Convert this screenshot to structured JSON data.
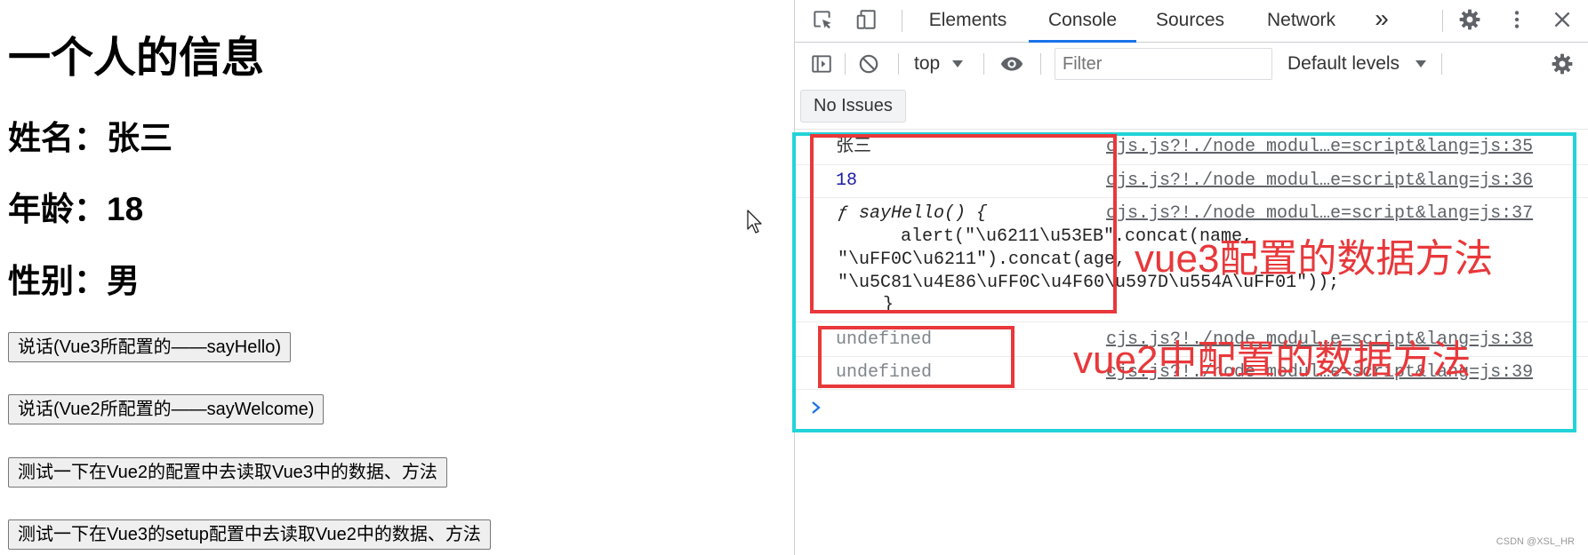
{
  "page": {
    "heading": "一个人的信息",
    "fields": [
      {
        "label": "姓名：",
        "value": "张三"
      },
      {
        "label": "年龄：",
        "value": "18"
      },
      {
        "label": "性别：",
        "value": "男"
      }
    ],
    "buttons": [
      "说话(Vue3所配置的——sayHello)",
      "说话(Vue2所配置的——sayWelcome)",
      "测试一下在Vue2的配置中去读取Vue3中的数据、方法",
      "测试一下在Vue3的setup配置中去读取Vue2中的数据、方法"
    ]
  },
  "devtools": {
    "toolbar": {
      "tabs": [
        {
          "label": "Elements",
          "active": false
        },
        {
          "label": "Console",
          "active": true
        },
        {
          "label": "Sources",
          "active": false
        },
        {
          "label": "Network",
          "active": false
        }
      ],
      "overflow": "»",
      "icons": [
        "inspect-element-icon",
        "device-toolbar-icon",
        "settings-gear-icon",
        "more-options-icon",
        "close-icon"
      ]
    },
    "console_toolbar": {
      "context": "top",
      "filter_placeholder": "Filter",
      "levels": "Default levels",
      "icons": [
        "sidebar-toggle-icon",
        "clear-console-icon",
        "live-expression-eye-icon",
        "console-settings-gear-icon"
      ]
    },
    "issues": "No Issues",
    "messages": [
      {
        "text": "张三",
        "source": "cjs.js?!./node_modul…e=script&lang=js:35"
      },
      {
        "text": "18",
        "source": "cjs.js?!./node_modul…e=script&lang=js:36"
      },
      {
        "lines": [
          "ƒ sayHello() {",
          "alert(\"\\u6211\\u53EB\".concat(name,",
          "\"\\uFF0C\\u6211\").concat(age,",
          "\"\\u5C81\\u4E86\\uFF0C\\u4F60\\u597D\\u554A\\uFF01\"));",
          "}"
        ],
        "source": "cjs.js?!./node_modul…e=script&lang=js:37"
      },
      {
        "text": "undefined",
        "source": "cjs.js?!./node_modul…e=script&lang=js:38"
      },
      {
        "text": "undefined",
        "source": "cjs.js?!./node_modul…e=script&lang=js:39"
      }
    ]
  },
  "annotations": {
    "vue3_note": "vue3配置的数据方法",
    "vue2_note": "vue2中配置的数据方法"
  },
  "watermark": "CSDN @XSL_HR",
  "colors": {
    "accent": "#1a73e8",
    "highlight_border": "#22d3d9",
    "annotation_red": "#e8383b",
    "number": "#1a1aa6",
    "undefined": "#80868b"
  }
}
